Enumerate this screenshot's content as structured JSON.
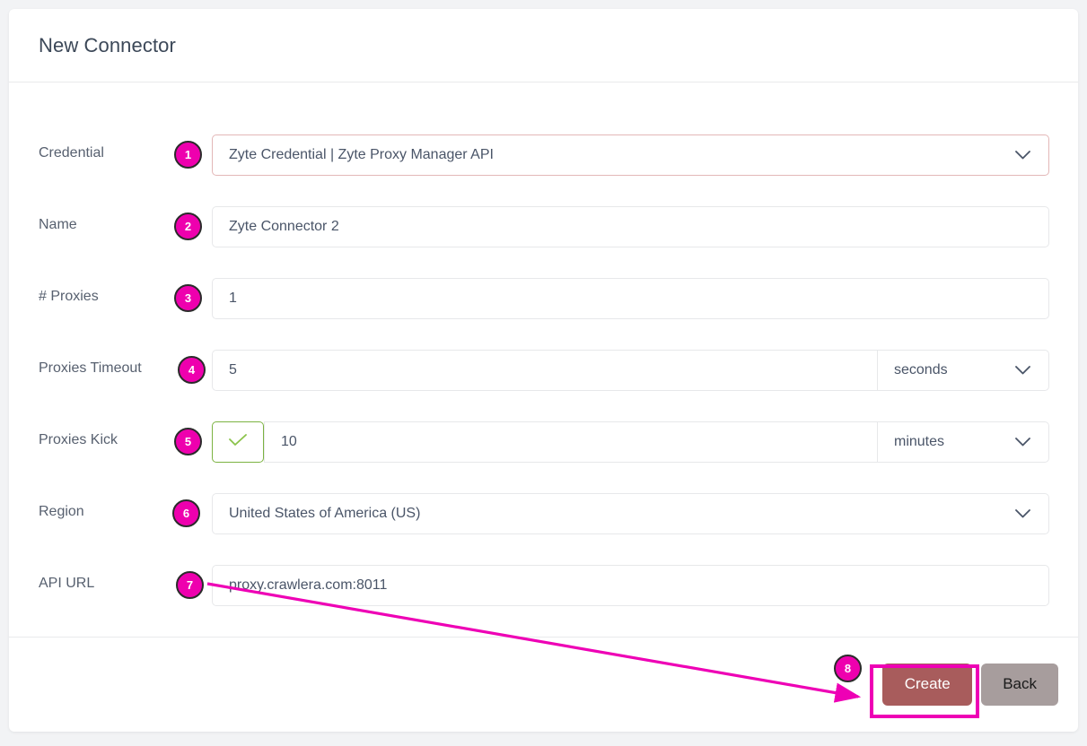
{
  "page": {
    "title": "New Connector",
    "background_color": "#f2f3f5",
    "card_color": "#ffffff"
  },
  "annotations": {
    "accent_color": "#ee00b5",
    "badges": [
      "1",
      "2",
      "3",
      "4",
      "5",
      "6",
      "7",
      "8"
    ]
  },
  "form": {
    "rows": [
      {
        "label": "Credential",
        "badge": "1",
        "value": "Zyte Credential | Zyte Proxy Manager API",
        "control": "select",
        "icon": "chevron-down-icon",
        "name": "credential"
      },
      {
        "label": "Name",
        "badge": "2",
        "value": "Zyte Connector 2",
        "control": "text",
        "name": "name"
      },
      {
        "label": "# Proxies",
        "badge": "3",
        "value": "1",
        "control": "text",
        "name": "num-proxies"
      },
      {
        "label": "Proxies Timeout",
        "badge": "4",
        "value": "5",
        "control": "text",
        "unit": "seconds",
        "unit_icon": "chevron-down-icon",
        "name": "proxies-timeout"
      },
      {
        "label": "Proxies Kick",
        "badge": "5",
        "value": "10",
        "control": "text",
        "checkbox": true,
        "checkbox_icon": "check-icon",
        "unit": "minutes",
        "unit_icon": "chevron-down-icon",
        "name": "proxies-kick"
      },
      {
        "label": "Region",
        "badge": "6",
        "value": "United States of America (US)",
        "control": "select",
        "icon": "chevron-down-icon",
        "name": "region"
      },
      {
        "label": "API URL",
        "badge": "7",
        "value": "proxy.crawlera.com:8011",
        "control": "text",
        "name": "api-url"
      }
    ]
  },
  "footer": {
    "badge": "8",
    "create_label": "Create",
    "back_label": "Back",
    "create_color": "#a85c5c",
    "back_color": "#a79d9d"
  }
}
